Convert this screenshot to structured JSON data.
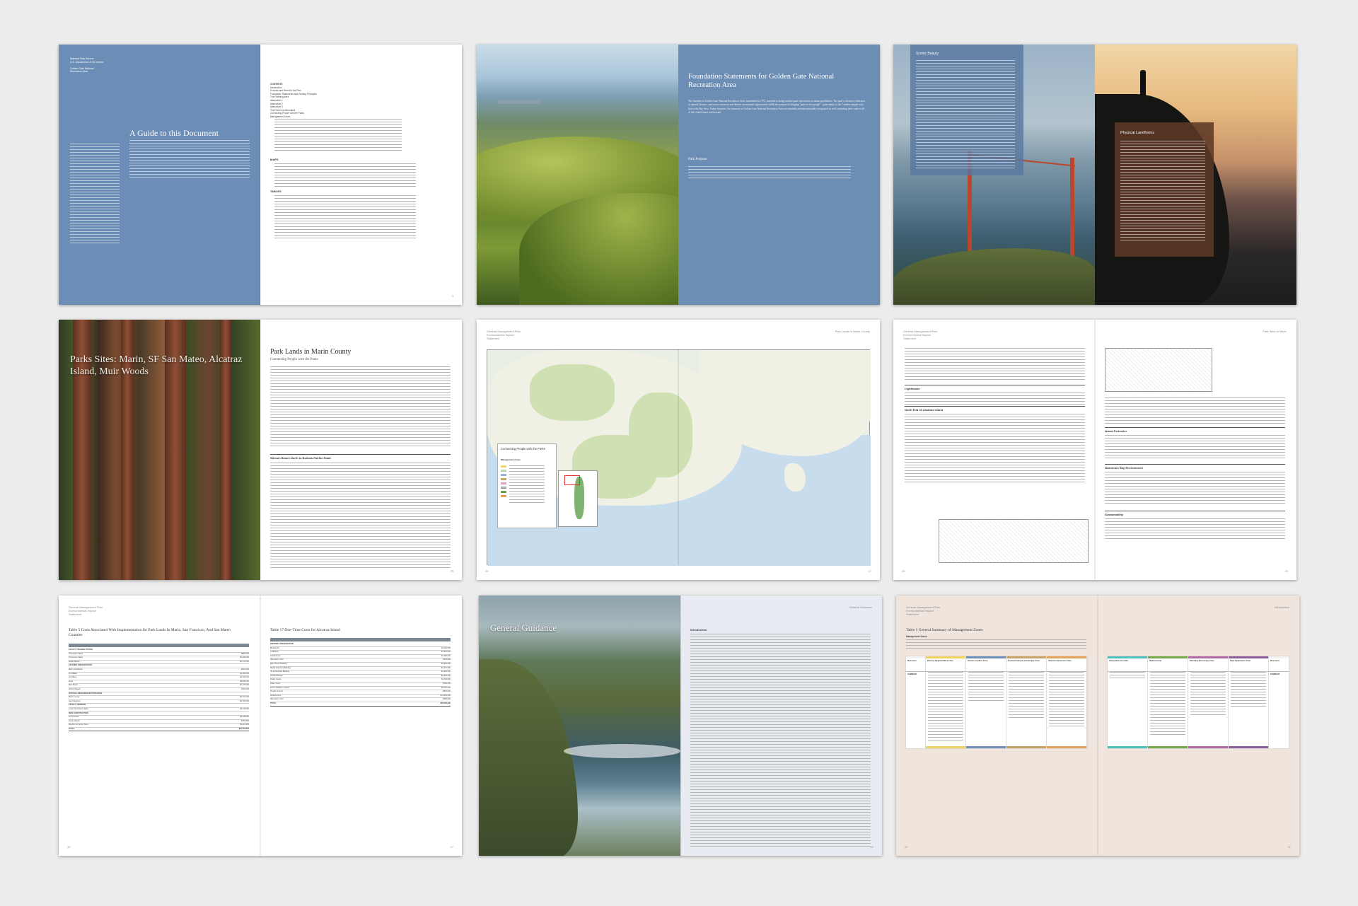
{
  "colors": {
    "blue_panel": "#6b8db6",
    "brown_panel": "#5c3824",
    "tan_page": "#efe5dd",
    "page_bg": "#ececec"
  },
  "spread1": {
    "small_header": "National Park Service\nU.S. Department of the Interior\n\nGolden Gate National\nRecreation Area",
    "title": "A Guide to this Document",
    "toc_heading": "CONTENTS",
    "toc_items": [
      "Introduction",
      "Purpose and Need for the Plan",
      "Foundation Statements and Guiding Principles",
      "The Planning Area",
      "Alternative 1",
      "Alternative 2",
      "Alternative 3",
      "The Preferred Alternative",
      "Connecting People with the Parks",
      "Management Zones"
    ],
    "maps_heading": "MAPS",
    "tables_heading": "TABLES",
    "page_left": "",
    "page_right": "3"
  },
  "spread2": {
    "title": "Foundation Statements for Golden Gate National Recreation Area",
    "body": "The founders of Golden Gate National Recreation Area, established in 1972, intended to bring national park experiences to urban populations. The park's extensive collection of natural, historic, and scenic resources and diverse recreational opportunities fulfill the purpose of bringing \"parks to the people\" - particularly to the 7 million people who live in the Bay Area. Today, however, the resources of Golden Gate National Recreation Area are naturally and internationally recognized as well, extending their value to all of the United States and beyond.",
    "subhead": "Park Purpose"
  },
  "spread3": {
    "scenic_title": "Scenic Beauty",
    "physical_title": "Physical Landforms"
  },
  "spread4": {
    "photo_title": "Parks Sites: Marin, SF San Mateo, Alcatraz Island, Muir Woods",
    "title": "Park Lands in Marin County",
    "subtitle": "Connecting People with the Parks",
    "section1": "Stinson Beach North to Bolinas-Fairfax Road",
    "page_right": "25"
  },
  "spread5": {
    "runhead_left": "General Management Plan\nEnvironmental Impact\nStatement",
    "runhead_right": "Park Lands in Marin County",
    "legend_title": "Connecting People with the Parks",
    "legend_zones": "Management Zones",
    "page_left": "26",
    "page_right": "27"
  },
  "spread6": {
    "runhead_left": "General Management Plan\nEnvironmental Impact\nStatement",
    "runhead_right": "Park Sites in Marin",
    "sec_lighthouse": "Lighthouse",
    "sec_north_end": "North End Of Alcatraz Island",
    "sec_perimeter": "Island Perimeter",
    "sec_nearshore": "Nearshore Bay Environment",
    "sec_sustain": "Sustainability",
    "page_left": "28",
    "page_right": "29"
  },
  "spread7": {
    "runhead_left": "General Management Plan\nEnvironmental Impact\nStatement",
    "table_left_title": "Table 5 Costs Associated With Implementation for Park Lands In Marin, San Francisco, And San Mateo Counties",
    "table_right_title": "Table 17 One-Time Costs for Alcatraz Island",
    "total_label": "TOTAL",
    "total_left": "$46,778,000",
    "total_right": "$56,339,000",
    "page_left": "46",
    "page_right": "47",
    "rows_left": [
      [
        "FACILITY REHABILITATION",
        ""
      ],
      [
        "Tennessee Valley",
        "$850,000"
      ],
      [
        "Tennessee Valley",
        "$2,400,000"
      ],
      [
        "Rodeo Beach",
        "$2,570,000"
      ],
      [
        "HISTORIC PRESERVATION",
        ""
      ],
      [
        "Marin Headlands",
        "$910,000"
      ],
      [
        "Fort Baker",
        "$1,100,000"
      ],
      [
        "Fort Barry",
        "$4,490,000"
      ],
      [
        "Forts",
        "$9,800,000"
      ],
      [
        "Muir Beach",
        "$2,178,000"
      ],
      [
        "Stinson Beach",
        "$760,000"
      ],
      [
        "NATURAL RESOURCE RESTORATION",
        ""
      ],
      [
        "Marin County",
        "$2,710,000"
      ],
      [
        "San Francisco",
        "$4,700,000"
      ],
      [
        "FACILITY REMOVAL",
        ""
      ],
      [
        "Lower Tennessee Valley",
        "$1,140,000"
      ],
      [
        "NEW CONSTRUCTION",
        ""
      ],
      [
        "Fort Funston",
        "$1,238,000"
      ],
      [
        "Ocean Beach",
        "$750,000"
      ],
      [
        "Rancho Corral de Tierra",
        "$3,012,000"
      ]
    ],
    "rows_right": [
      [
        "HISTORIC PRESERVATION",
        ""
      ],
      [
        "Building 64",
        "$1,060,000"
      ],
      [
        "Cellhouse",
        "$1,310,000"
      ],
      [
        "Guardhouse",
        "$2,780,000"
      ],
      [
        "Recreation Yard",
        "$700,000"
      ],
      [
        "Main Prison Building",
        "$5,400,000"
      ],
      [
        "Model Industries Building",
        "$2,270,000"
      ],
      [
        "New Industries Building",
        "$4,200,000"
      ],
      [
        "Post Exchange",
        "$8,400,000"
      ],
      [
        "Power House",
        "$1,000,000"
      ],
      [
        "Water Tower",
        "$750,000"
      ],
      [
        "Prison Warden's House",
        "$2,010,000"
      ],
      [
        "Parade Ground",
        "$530,000"
      ],
      [
        "Infrastructure",
        "$11,000,000"
      ],
      [
        "Recreation Yard",
        "$380,000"
      ]
    ]
  },
  "spread8": {
    "photo_title": "General Guidance",
    "intro_heading": "Introduction",
    "runhead_right": "General Guidance",
    "page_right": "49"
  },
  "spread9": {
    "runhead_left": "General Management Plan\nEnvironmental Impact\nStatement",
    "runhead_right": "Introduction",
    "table_title": "Table 1 General Summary of Management Zones",
    "table_sub": "Management Zones",
    "left_cols": [
      "Resource",
      "Diverse Opportunities Zone",
      "Scenic Corridor Zone",
      "Evolved Cultural Landscape Zone",
      "Historic Immersion Zone"
    ],
    "right_cols": [
      "Interpretive Corridor",
      "Natural Zone",
      "Sensitive Resources Zone",
      "Park Operations Zone",
      "Resource"
    ],
    "summary": "SUMMARY",
    "page_left": "30",
    "page_right": "31"
  }
}
